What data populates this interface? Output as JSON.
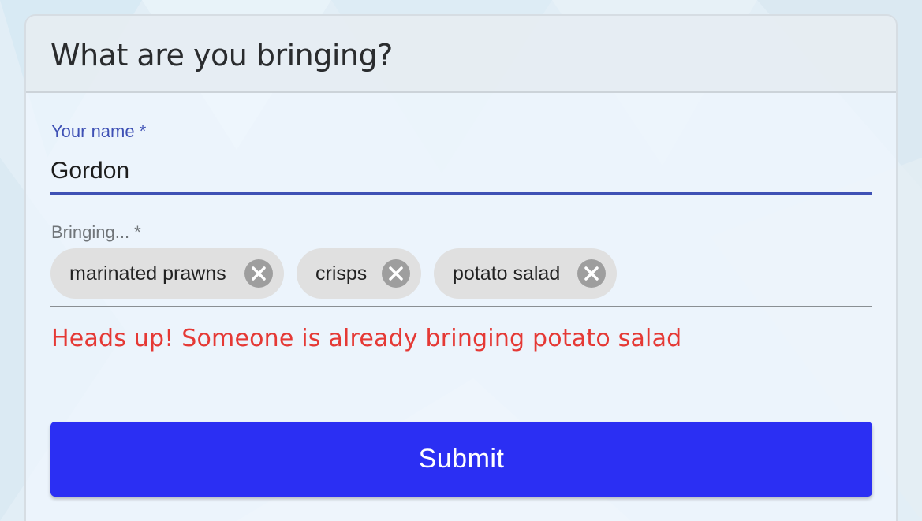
{
  "form": {
    "title": "What are you bringing?",
    "name_field": {
      "label": "Your name *",
      "value": "Gordon"
    },
    "bringing_field": {
      "label": "Bringing... *",
      "chips": [
        {
          "label": "marinated prawns",
          "remove_icon": "close-circle-icon"
        },
        {
          "label": "crisps",
          "remove_icon": "close-circle-icon"
        },
        {
          "label": "potato salad",
          "remove_icon": "close-circle-icon"
        }
      ]
    },
    "error_message": "Heads up! Someone is already bringing potato salad",
    "submit_label": "Submit"
  },
  "colors": {
    "accent": "#3f51b5",
    "error": "#e53935",
    "submit_bg": "#2b2ff3",
    "chip_bg": "#e0e0e0"
  }
}
